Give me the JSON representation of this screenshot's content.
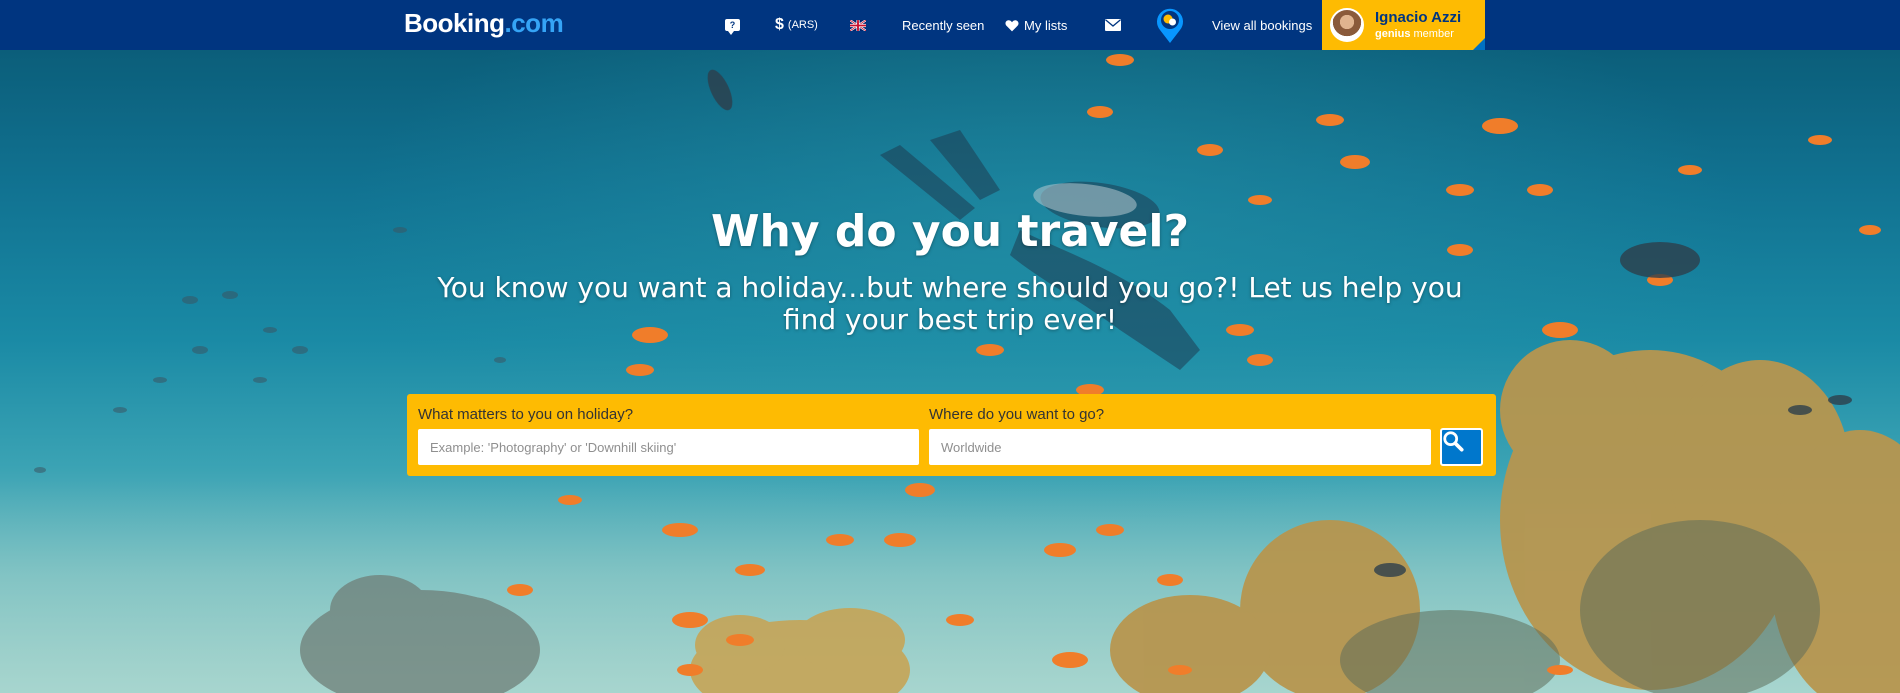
{
  "header": {
    "logo_main": "Booking",
    "logo_suffix": ".com",
    "help_glyph": "?",
    "currency_symbol": "$",
    "currency_code": "(ARS)",
    "language_icon": "uk-flag-icon",
    "recently_seen": "Recently seen",
    "my_lists": "My lists",
    "view_all_bookings": "View all bookings",
    "user": {
      "name": "Ignacio Azzi",
      "genius_bold": "genius",
      "genius_rest": " member"
    }
  },
  "hero": {
    "title": "Why do you travel?",
    "subtitle": "You know you want a holiday...but where should you go?! Let us help you find your best trip ever!"
  },
  "search": {
    "interest_label": "What matters to you on holiday?",
    "interest_placeholder": "Example: 'Photography' or 'Downhill skiing'",
    "destination_label": "Where do you want to go?",
    "destination_placeholder": "Worldwide",
    "button_icon": "search-icon"
  },
  "colors": {
    "header_bg": "#003580",
    "genius_yellow": "#febb02",
    "search_button": "#0077cc",
    "logo_accent": "#35a4f6"
  }
}
